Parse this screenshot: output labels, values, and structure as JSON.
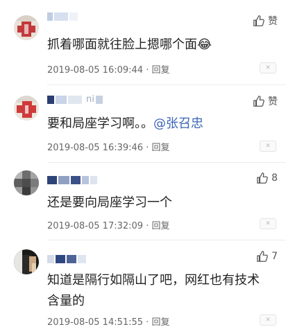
{
  "comments": [
    {
      "text": "抓着哪面就往脸上摁哪个面",
      "emoji": "😂",
      "like_label": "赞",
      "timestamp": "2019-08-05 16:09:44",
      "reply_label": "回复",
      "avatar_icon": "avatar-red-cross-icon"
    },
    {
      "name_suffix": "ni",
      "text": "要和局座学习啊。。",
      "mention": "@张召忠",
      "like_label": "赞",
      "timestamp": "2019-08-05 16:39:46",
      "reply_label": "回复",
      "avatar_icon": "avatar-red-cross-icon"
    },
    {
      "text": "还是要向局座学习一个",
      "like_count": "8",
      "timestamp": "2019-08-05 17:32:09",
      "reply_label": "回复",
      "avatar_icon": "avatar-gray-mosaic-icon"
    },
    {
      "text_line1": "知道是隔行如隔山了吧，网红也有技术",
      "text_line2": "含量的",
      "like_count": "7",
      "timestamp": "2019-08-05 14:51:55",
      "reply_label": "回复",
      "avatar_icon": "avatar-dark-figure-icon"
    }
  ],
  "colors": {
    "link": "#3b63b6",
    "meta_text": "#666666",
    "name_blur": "#9aa7c0"
  }
}
